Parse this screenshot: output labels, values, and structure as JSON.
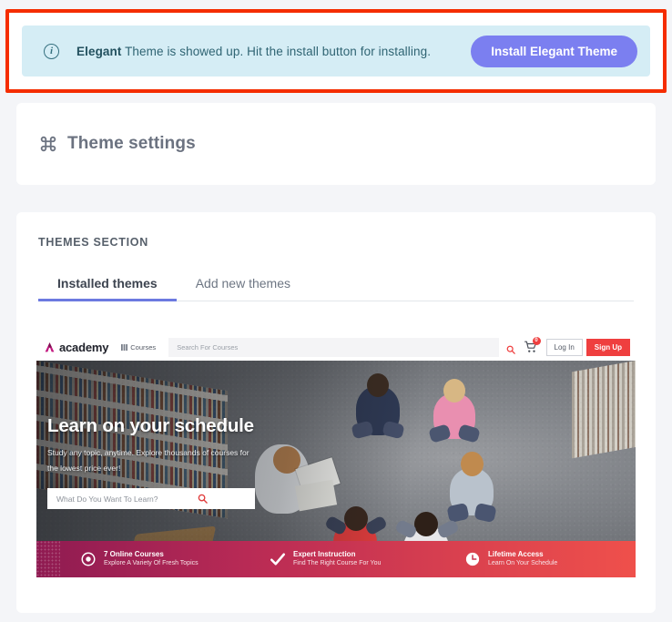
{
  "colors": {
    "page_bg": "#f4f5f8",
    "annotation_border": "#f52d00",
    "notice_bg": "#d5edf5",
    "notice_text": "#2f6473",
    "install_button_bg": "#7b7ff0",
    "tab_active_underline": "#6c7ae0",
    "brand_red": "#ef3f3f",
    "logo_magenta": "#c2177f"
  },
  "notice": {
    "icon": "info-circle-icon",
    "bold_prefix": "Elegant",
    "message": " Theme is showed up. Hit the install button for installing.",
    "button_label": "Install Elegant Theme"
  },
  "settings": {
    "icon": "command-loop-icon",
    "title": "Theme settings"
  },
  "themes": {
    "section_label": "THEMES SECTION",
    "tabs": [
      {
        "label": "Installed themes",
        "active": true
      },
      {
        "label": "Add new themes",
        "active": false
      }
    ]
  },
  "preview": {
    "nav": {
      "logo_mark": "academy-triangle-logo-icon",
      "logo_text": "academy",
      "courses_icon": "grid-icon",
      "courses_label": "Courses",
      "search_placeholder": "Search For Courses",
      "search_icon": "search-icon",
      "cart_icon": "shopping-cart-icon",
      "cart_badge": "0",
      "login_label": "Log In",
      "signup_label": "Sign Up"
    },
    "hero": {
      "title": "Learn on your schedule",
      "subtitle_line1": "Study any topic, anytime. Explore thousands of courses for",
      "subtitle_line2": "the lowest price ever!",
      "search_placeholder": "What Do You Want To Learn?",
      "search_icon": "search-icon"
    },
    "features": [
      {
        "icon": "target-icon",
        "title": "7 Online Courses",
        "subtitle": "Explore A Variety Of Fresh Topics"
      },
      {
        "icon": "check-icon",
        "title": "Expert Instruction",
        "subtitle": "Find The Right Course For You"
      },
      {
        "icon": "clock-icon",
        "title": "Lifetime Access",
        "subtitle": "Learn On Your Schedule"
      }
    ]
  }
}
